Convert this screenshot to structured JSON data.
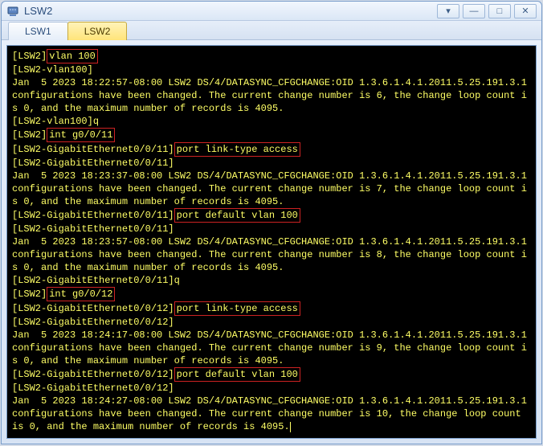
{
  "window": {
    "title": "LSW2",
    "icon_name": "device-icon"
  },
  "win_buttons": {
    "menu": "▾",
    "minimize": "—",
    "maximize": "□",
    "close": "✕"
  },
  "tabs": [
    {
      "label": "LSW1",
      "active": false
    },
    {
      "label": "LSW2",
      "active": true
    }
  ],
  "terminal": {
    "lines": [
      {
        "segments": [
          {
            "text": "[LSW2]"
          },
          {
            "text": "vlan 100",
            "boxed": true
          }
        ]
      },
      {
        "segments": [
          {
            "text": "[LSW2-vlan100]"
          }
        ]
      },
      {
        "segments": [
          {
            "text": "Jan  5 2023 18:22:57-08:00 LSW2 DS/4/DATASYNC_CFGCHANGE:OID 1.3.6.1.4.1.2011.5.25.191.3.1 configurations have been changed. The current change number is 6, the change loop count is 0, and the maximum number of records is 4095."
          }
        ]
      },
      {
        "segments": [
          {
            "text": "[LSW2-vlan100]q"
          }
        ]
      },
      {
        "segments": [
          {
            "text": "[LSW2]"
          },
          {
            "text": "int g0/0/11",
            "boxed": true
          }
        ]
      },
      {
        "segments": [
          {
            "text": "[LSW2-GigabitEthernet0/0/11]"
          },
          {
            "text": "port link-type access",
            "boxed": true
          }
        ]
      },
      {
        "segments": [
          {
            "text": "[LSW2-GigabitEthernet0/0/11]"
          }
        ]
      },
      {
        "segments": [
          {
            "text": "Jan  5 2023 18:23:37-08:00 LSW2 DS/4/DATASYNC_CFGCHANGE:OID 1.3.6.1.4.1.2011.5.25.191.3.1 configurations have been changed. The current change number is 7, the change loop count is 0, and the maximum number of records is 4095."
          }
        ]
      },
      {
        "segments": [
          {
            "text": "[LSW2-GigabitEthernet0/0/11]"
          },
          {
            "text": "port default vlan 100",
            "boxed": true
          }
        ]
      },
      {
        "segments": [
          {
            "text": "[LSW2-GigabitEthernet0/0/11]"
          }
        ]
      },
      {
        "segments": [
          {
            "text": "Jan  5 2023 18:23:57-08:00 LSW2 DS/4/DATASYNC_CFGCHANGE:OID 1.3.6.1.4.1.2011.5.25.191.3.1 configurations have been changed. The current change number is 8, the change loop count is 0, and the maximum number of records is 4095."
          }
        ]
      },
      {
        "segments": [
          {
            "text": "[LSW2-GigabitEthernet0/0/11]q"
          }
        ]
      },
      {
        "segments": [
          {
            "text": "[LSW2]"
          },
          {
            "text": "int g0/0/12",
            "boxed": true
          }
        ]
      },
      {
        "segments": [
          {
            "text": "[LSW2-GigabitEthernet0/0/12]"
          },
          {
            "text": "port link-type access",
            "boxed": true
          }
        ]
      },
      {
        "segments": [
          {
            "text": "[LSW2-GigabitEthernet0/0/12]"
          }
        ]
      },
      {
        "segments": [
          {
            "text": "Jan  5 2023 18:24:17-08:00 LSW2 DS/4/DATASYNC_CFGCHANGE:OID 1.3.6.1.4.1.2011.5.25.191.3.1 configurations have been changed. The current change number is 9, the change loop count is 0, and the maximum number of records is 4095."
          }
        ]
      },
      {
        "segments": [
          {
            "text": "[LSW2-GigabitEthernet0/0/12]"
          },
          {
            "text": "port default vlan 100",
            "boxed": true
          }
        ]
      },
      {
        "segments": [
          {
            "text": "[LSW2-GigabitEthernet0/0/12]"
          }
        ]
      },
      {
        "segments": [
          {
            "text": "Jan  5 2023 18:24:27-08:00 LSW2 DS/4/DATASYNC_CFGCHANGE:OID 1.3.6.1.4.1.2011.5.25.191.3.1 configurations have been changed. The current change number is 10, the change loop count is 0, and the maximum number of records is 4095."
          }
        ],
        "cursor": true
      }
    ]
  }
}
